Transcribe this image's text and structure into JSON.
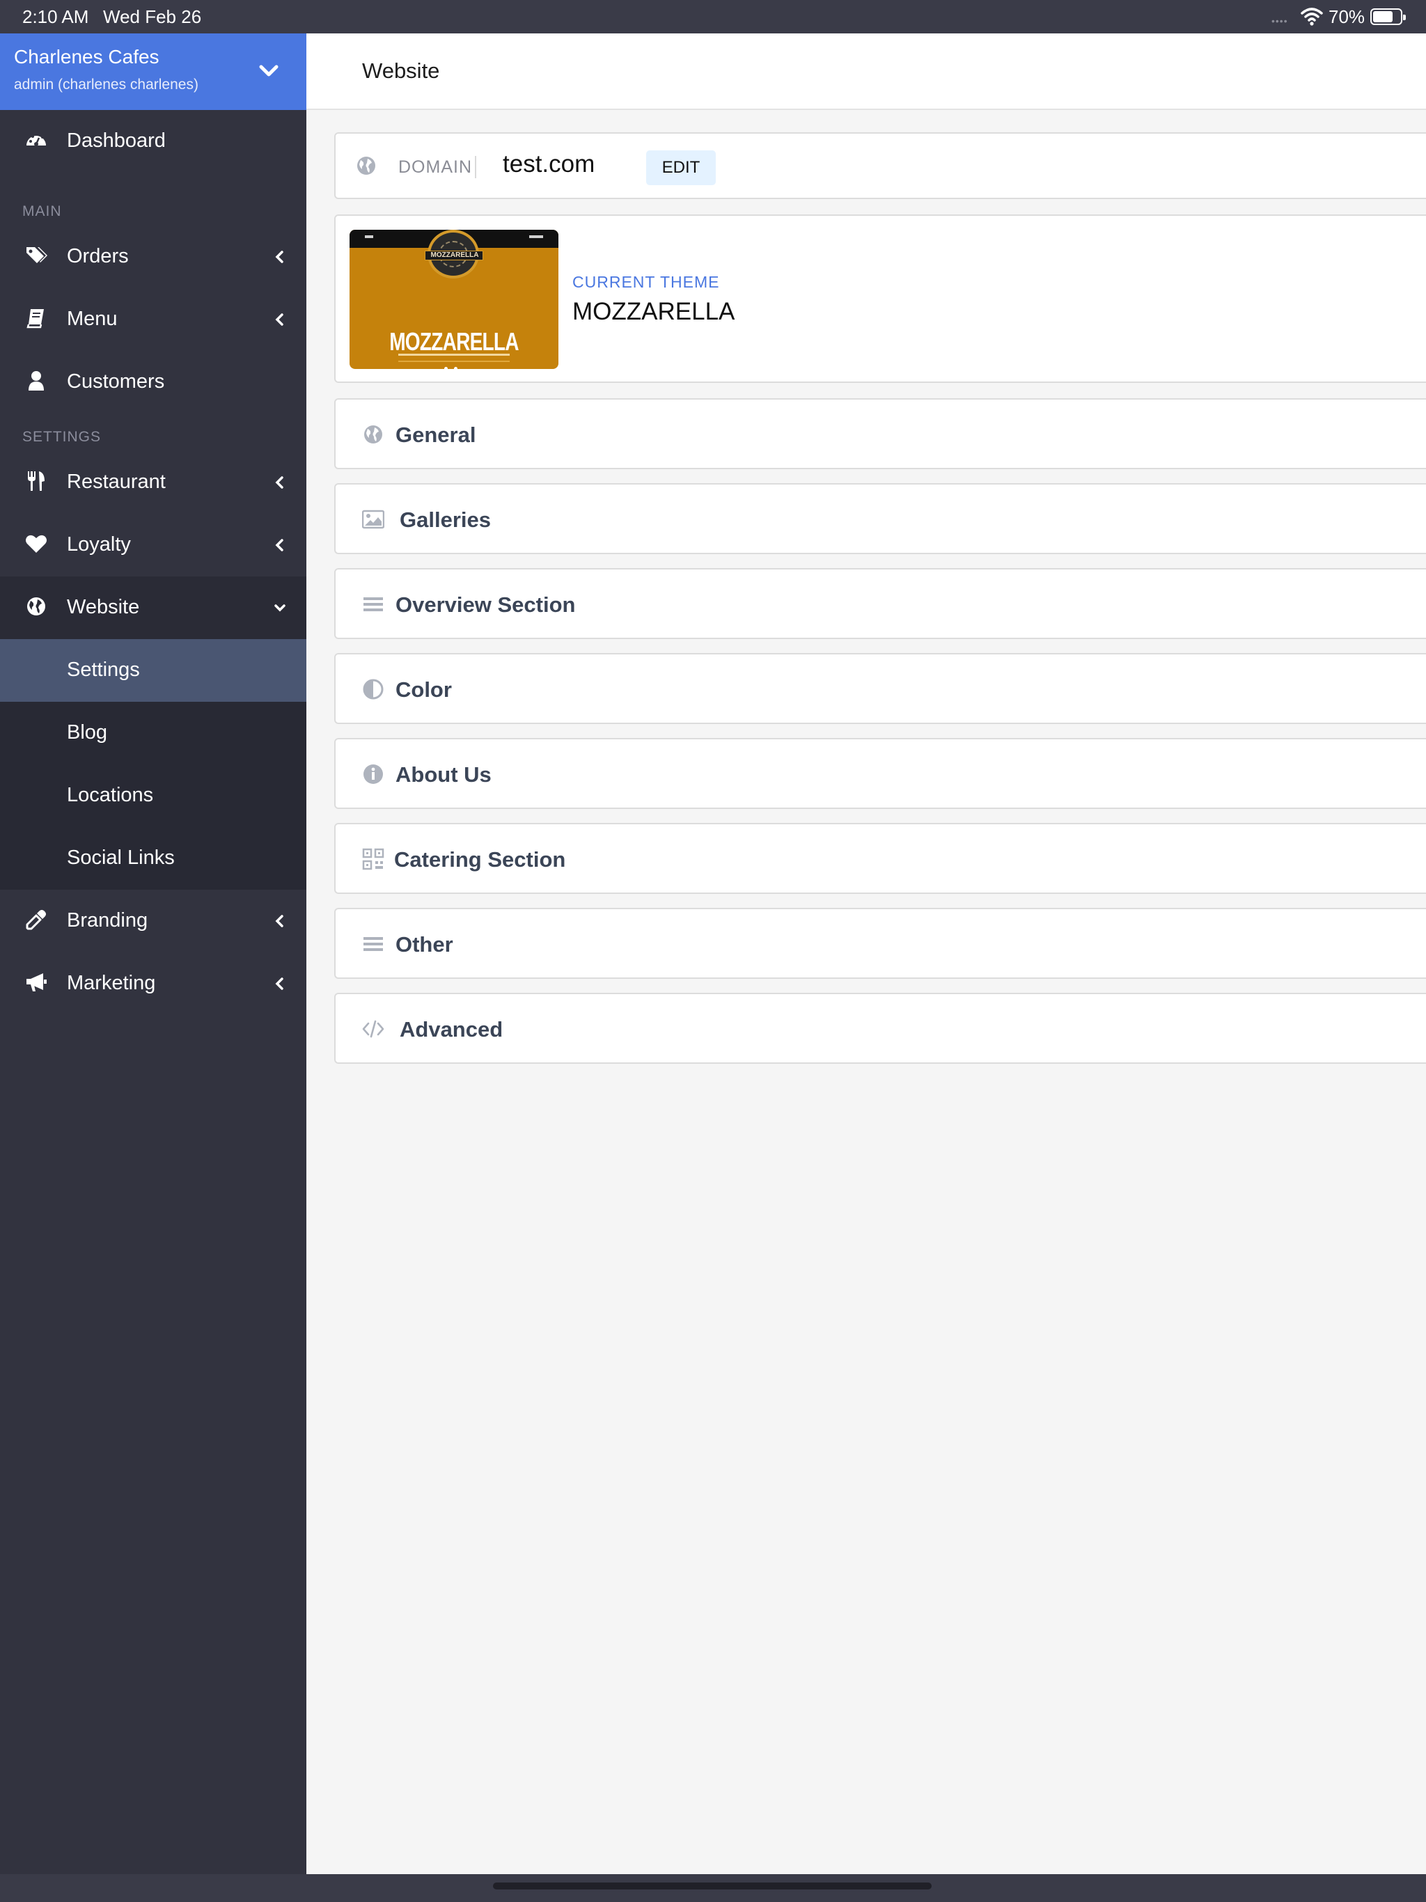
{
  "status_bar": {
    "time": "2:10 AM",
    "date": "Wed Feb 26",
    "battery_pct": "70%",
    "signal_indicator": "••••"
  },
  "account": {
    "name": "Charlenes Cafes",
    "sub": "admin (charlenes charlenes)"
  },
  "sidebar": {
    "dashboard": "Dashboard",
    "main_label": "MAIN",
    "orders": "Orders",
    "menu": "Menu",
    "customers": "Customers",
    "settings_label": "SETTINGS",
    "restaurant": "Restaurant",
    "loyalty": "Loyalty",
    "website": "Website",
    "website_children": [
      "Settings",
      "Blog",
      "Locations",
      "Social Links"
    ],
    "branding": "Branding",
    "marketing": "Marketing",
    "active_child": "Settings"
  },
  "header": {
    "title": "Website"
  },
  "domain": {
    "label": "DOMAIN",
    "value": "test.com",
    "edit_label": "EDIT"
  },
  "theme": {
    "label": "CURRENT THEME",
    "name": "MOZZARELLA",
    "thumb_title": "MOZZARELLA",
    "thumb_badge": "MOZZARELLA"
  },
  "sections": [
    {
      "label": "General",
      "icon": "globe-icon"
    },
    {
      "label": "Galleries",
      "icon": "image-icon"
    },
    {
      "label": "Overview Section",
      "icon": "list-icon"
    },
    {
      "label": "Color",
      "icon": "contrast-icon"
    },
    {
      "label": "About Us",
      "icon": "info-icon"
    },
    {
      "label": "Catering Section",
      "icon": "qrcode-icon"
    },
    {
      "label": "Other",
      "icon": "list-icon"
    },
    {
      "label": "Advanced",
      "icon": "code-icon"
    }
  ],
  "colors": {
    "accent": "#4a77e0",
    "sidebar_bg": "#32333f",
    "active_item_bg": "#4a5672",
    "edit_button_bg": "#e4f2ff",
    "theme_thumb_bg": "#c5820c"
  }
}
